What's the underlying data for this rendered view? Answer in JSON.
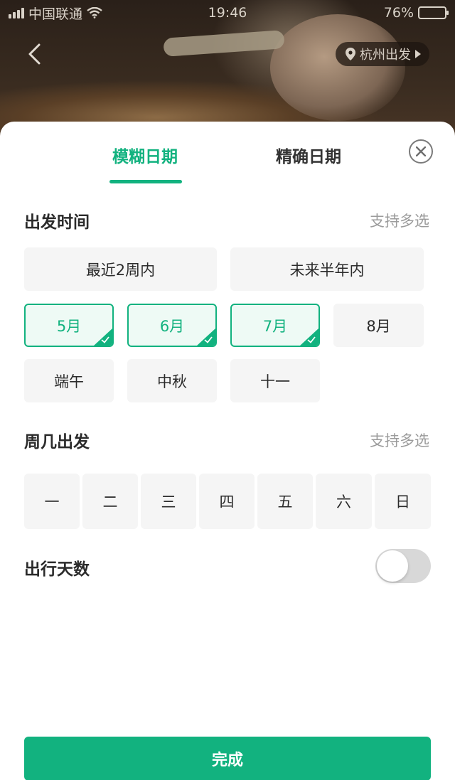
{
  "status_bar": {
    "carrier": "中国联通",
    "time": "19:46",
    "battery_text": "76%",
    "battery_level": 0.76
  },
  "header": {
    "back_icon": "chevron-left-icon",
    "location_icon": "map-pin-icon",
    "location_label": "杭州出发"
  },
  "tabs": [
    {
      "label": "模糊日期",
      "active": true
    },
    {
      "label": "精确日期",
      "active": false
    }
  ],
  "departure": {
    "title": "出发时间",
    "hint": "支持多选",
    "range_options": [
      {
        "label": "最近2周内",
        "selected": false
      },
      {
        "label": "未来半年内",
        "selected": false
      }
    ],
    "months": [
      {
        "label": "5月",
        "selected": true
      },
      {
        "label": "6月",
        "selected": true
      },
      {
        "label": "7月",
        "selected": true
      },
      {
        "label": "8月",
        "selected": false
      }
    ],
    "holidays": [
      {
        "label": "端午",
        "selected": false
      },
      {
        "label": "中秋",
        "selected": false
      },
      {
        "label": "十一",
        "selected": false
      }
    ]
  },
  "weekday": {
    "title": "周几出发",
    "hint": "支持多选",
    "days": [
      "一",
      "二",
      "三",
      "四",
      "五",
      "六",
      "日"
    ]
  },
  "trip_days": {
    "title": "出行天数",
    "toggle_on": false
  },
  "done_label": "完成",
  "colors": {
    "accent": "#12b27f",
    "chip_bg": "#f5f5f5",
    "selected_bg": "#eefaf5"
  }
}
